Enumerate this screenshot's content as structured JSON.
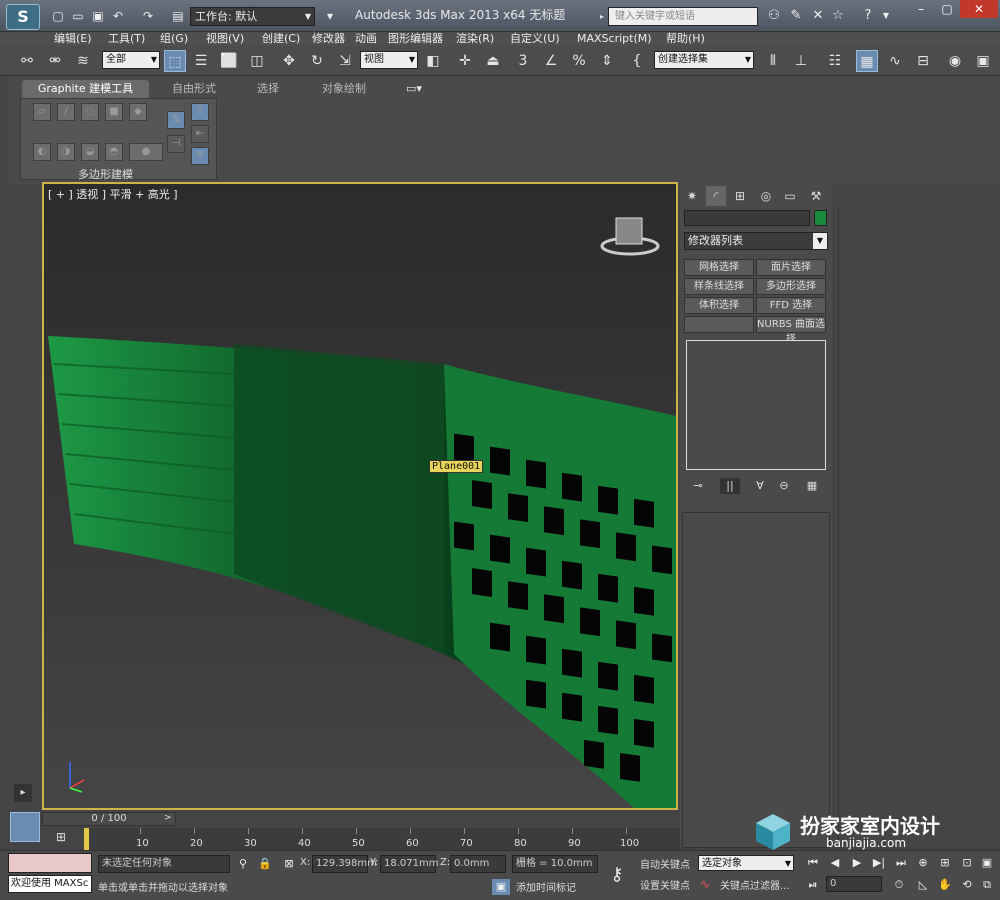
{
  "titlebar": {
    "workspace_label": "工作台: 默认",
    "app_title": "Autodesk 3ds Max  2013 x64      无标题",
    "search_placeholder": "键入关键字或短语"
  },
  "menubar": {
    "items": [
      "编辑(E)",
      "工具(T)",
      "组(G)",
      "视图(V)",
      "创建(C)",
      "修改器",
      "动画",
      "图形编辑器",
      "渲染(R)",
      "自定义(U)",
      "MAXScript(M)",
      "帮助(H)"
    ]
  },
  "toolbar": {
    "filter_value": "全部",
    "refcoord_value": "视图",
    "selection_set_value": "创建选择集",
    "snap_label": "3"
  },
  "ribbon": {
    "tabs": [
      "Graphite 建模工具",
      "自由形式",
      "选择",
      "对象绘制"
    ],
    "panel_label": "多边形建模"
  },
  "viewport": {
    "label": "[ + ] 透视 ] 平滑 + 高光 ]",
    "object_tag": "Plane001",
    "colors": {
      "green": "#1a8a3c",
      "dark": "#0a0a0a",
      "border": "#cdb34a"
    }
  },
  "command_panel": {
    "modifier_list": "修改器列表",
    "buttons": [
      "网格选择",
      "面片选择",
      "样条线选择",
      "多边形选择",
      "体积选择",
      "FFD 选择",
      "",
      "NURBS 曲面选择"
    ]
  },
  "timeline": {
    "slider_label": "0 / 100",
    "ticks": [
      "10",
      "20",
      "30",
      "40",
      "50",
      "60",
      "70",
      "80",
      "90",
      "100"
    ]
  },
  "status": {
    "listener_text": "欢迎使用 MAXSc",
    "selection_status": "未选定任何对象",
    "prompt": "单击或单击并拖动以选择对象",
    "x_value": "129.398mm",
    "y_value": "18.071mm",
    "z_value": "0.0mm",
    "grid_label": "栅格 = 10.0mm",
    "add_time_tag": "添加时间标记",
    "auto_key": "自动关键点",
    "set_key": "设置关键点",
    "selected_dropdown": "选定对象",
    "key_filters": "关键点过滤器...",
    "frame_value": "0"
  },
  "watermark": {
    "brand": "扮家家室内设计",
    "url": "banjiajia.com"
  }
}
